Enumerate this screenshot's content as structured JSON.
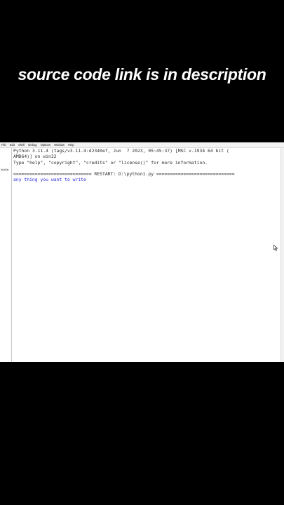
{
  "caption": "source code link is in description",
  "menu": [
    "File",
    "Edit",
    "Shell",
    "Debug",
    "Options",
    "Window",
    "Help"
  ],
  "shell": {
    "prompt": ">>>",
    "lines": [
      "Python 3.11.4 (tags/v3.11.4:d2340ef, Jun  7 2023, 05:45:37) [MSC v.1934 64 bit (",
      "AMD64)] on win32",
      "Type \"help\", \"copyright\", \"credits\" or \"license()\" for more information.",
      "",
      "============================= RESTART: D:\\python1.py ============================="
    ],
    "output": "any thing you want to write"
  },
  "colors": {
    "background": "#000000",
    "window": "#ffffff",
    "output_text": "#2b2bd8"
  },
  "icons": [
    "mouse-cursor-icon"
  ]
}
